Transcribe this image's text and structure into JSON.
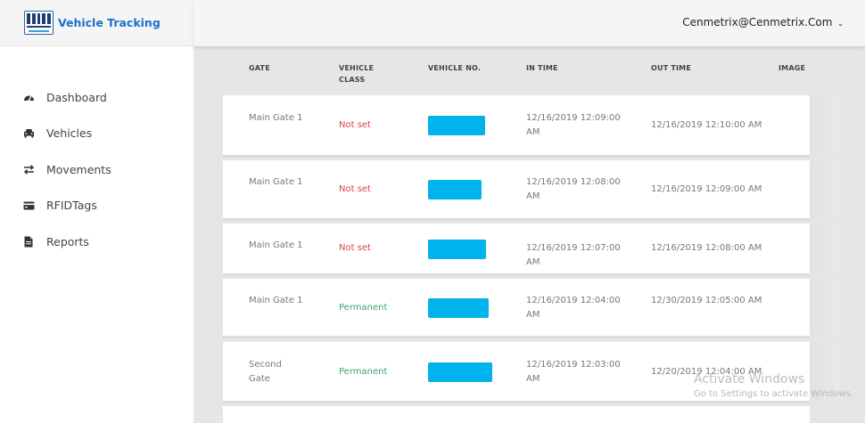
{
  "app": {
    "title": "Vehicle Tracking"
  },
  "user": {
    "email": "Cenmetrix@Cenmetrix.Com",
    "caret": "⌄"
  },
  "nav": [
    {
      "label": "Dashboard",
      "icon": "dashboard-icon"
    },
    {
      "label": "Vehicles",
      "icon": "car-icon"
    },
    {
      "label": "Movements",
      "icon": "swap-arrows-icon"
    },
    {
      "label": "RFIDTags",
      "icon": "card-icon"
    },
    {
      "label": "Reports",
      "icon": "file-icon"
    }
  ],
  "table": {
    "headers": {
      "gate": "GATE",
      "class": "VEHICLE CLASS",
      "vehicle_no": "VEHICLE NO.",
      "in_time": "IN TIME",
      "out_time": "OUT TIME",
      "image": "IMAGE"
    },
    "rows": [
      {
        "gate": "Main Gate 1",
        "class": "Not set",
        "in_time": "12/16/2019 12:09:00 AM",
        "out_time": "12/16/2019 12:10:00 AM"
      },
      {
        "gate": "Main Gate 1",
        "class": "Not set",
        "in_time": "12/16/2019 12:08:00 AM",
        "out_time": "12/16/2019 12:09:00 AM"
      },
      {
        "gate": "Main Gate 1",
        "class": "Not set",
        "in_time": "12/16/2019 12:07:00 AM",
        "out_time": "12/16/2019 12:08:00 AM"
      },
      {
        "gate": "Main Gate 1",
        "class": "Permanent",
        "in_time": "12/16/2019 12:04:00 AM",
        "out_time": "12/30/2019 12:05:00 AM"
      },
      {
        "gate": "Second Gate",
        "class": "Permanent",
        "in_time": "12/16/2019 12:03:00 AM",
        "out_time": "12/20/2019 12:04:00 AM"
      }
    ]
  },
  "watermark": {
    "line1": "Activate Windows",
    "line2": "Go to Settings to activate Windows."
  },
  "colors": {
    "accent": "#1a73c9",
    "plate": "#00b3ec",
    "not_set": "#d64545",
    "permanent": "#3aa56a"
  }
}
